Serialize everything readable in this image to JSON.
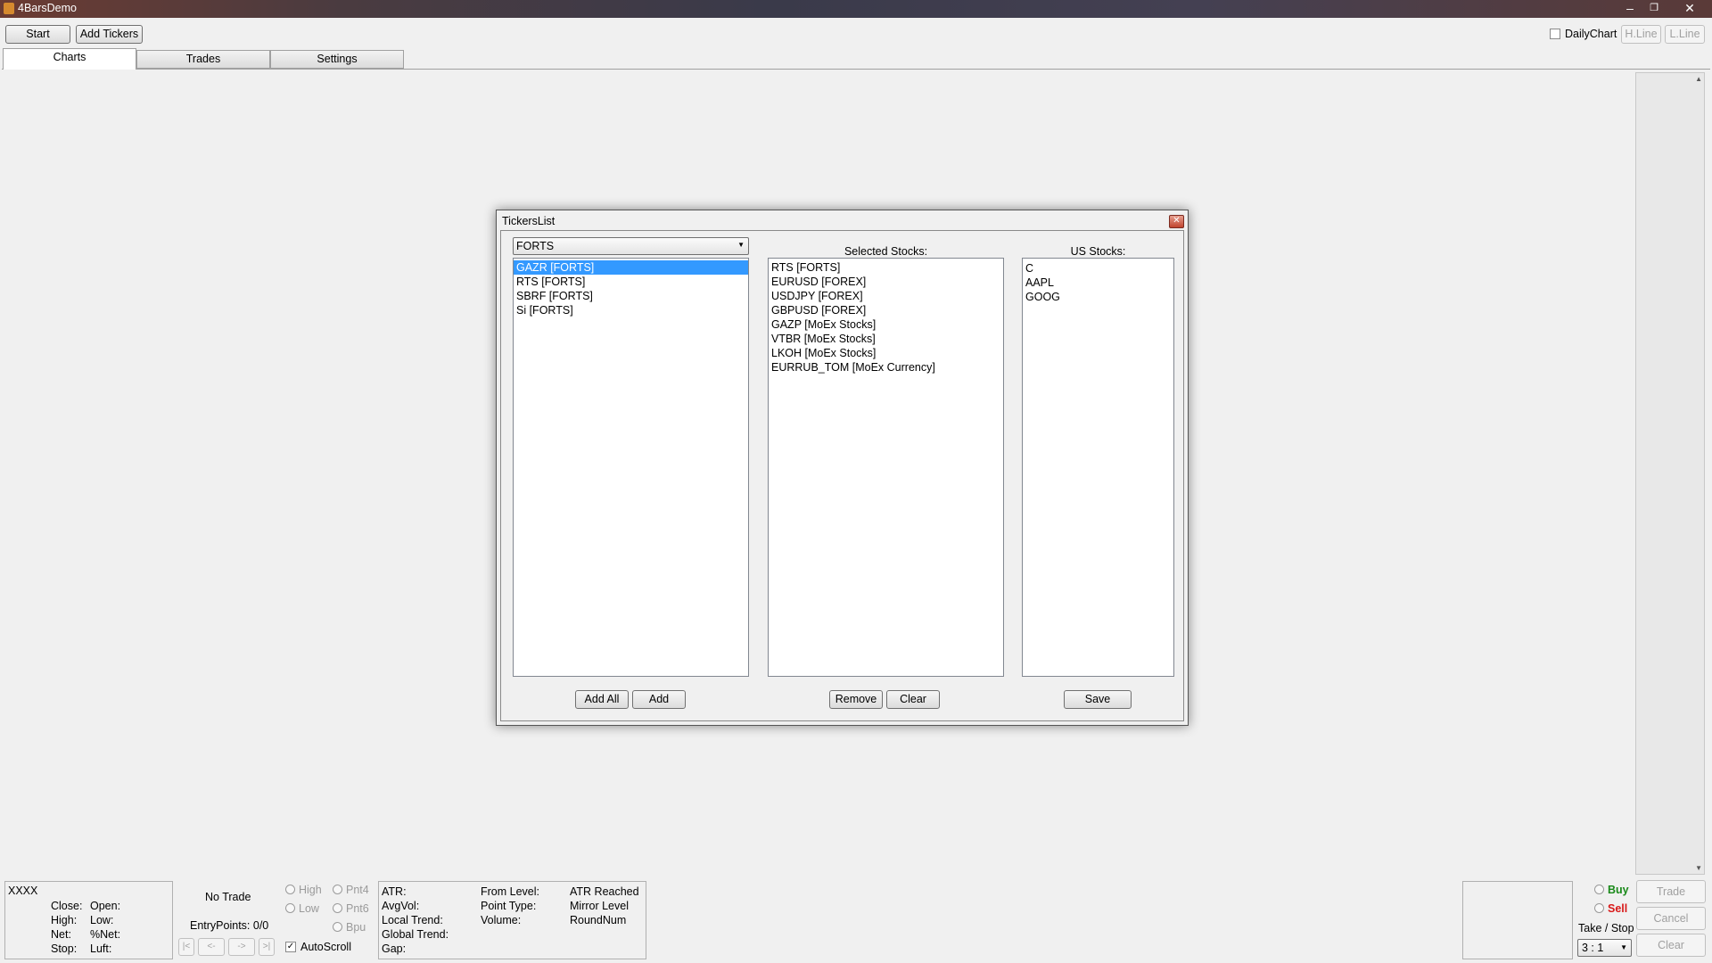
{
  "window": {
    "title": "4BarsDemo"
  },
  "toolbar": {
    "start_label": "Start",
    "add_tickers_label": "Add Tickers",
    "daily_chart_label": "DailyChart",
    "hline_label": "H.Line",
    "lline_label": "L.Line"
  },
  "tabs": [
    {
      "label": "Charts"
    },
    {
      "label": "Trades"
    },
    {
      "label": "Settings"
    }
  ],
  "dialog": {
    "title": "TickersList",
    "exchange_select": {
      "value": "FORTS"
    },
    "available": [
      "GAZR [FORTS]",
      "RTS [FORTS]",
      "SBRF [FORTS]",
      "Si [FORTS]"
    ],
    "selected_header": "Selected Stocks:",
    "selected": [
      "RTS [FORTS]",
      "EURUSD [FOREX]",
      "USDJPY [FOREX]",
      "GBPUSD [FOREX]",
      "GAZP [MoEx Stocks]",
      "VTBR [MoEx Stocks]",
      "LKOH [MoEx Stocks]",
      "EURRUB_TOM [MoEx Currency]"
    ],
    "us_header": "US Stocks:",
    "us_stocks": [
      "C",
      "AAPL",
      "GOOG"
    ],
    "buttons": {
      "add_all": "Add All",
      "add": "Add",
      "remove": "Remove",
      "clear": "Clear",
      "save": "Save"
    }
  },
  "info": {
    "ticker": "XXXX",
    "close": "Close:",
    "open": "Open:",
    "high": "High:",
    "low": "Low:",
    "net": "Net:",
    "pnet": "%Net:",
    "stop": "Stop:",
    "luft": "Luft:",
    "no_trade": "No Trade",
    "entry_points": "EntryPoints: 0/0",
    "nav": [
      "|<",
      "<-",
      "->",
      ">|"
    ],
    "autoscroll": "AutoScroll",
    "radios": {
      "high": "High",
      "low": "Low",
      "pnt4": "Pnt4",
      "pnt6": "Pnt6",
      "bpu": "Bpu"
    },
    "stats_col1": [
      "ATR:",
      "AvgVol:",
      "Local Trend:",
      "Global Trend:",
      "Gap:"
    ],
    "stats_col2": [
      "From Level:",
      "Point Type:",
      "Volume:"
    ],
    "stats_col3": [
      "ATR Reached",
      "Mirror Level",
      "RoundNum"
    ]
  },
  "trade": {
    "buy": "Buy",
    "sell": "Sell",
    "take_stop": "Take / Stop",
    "ratio": "3 : 1",
    "trade_btn": "Trade",
    "cancel_btn": "Cancel",
    "clear_btn": "Clear"
  },
  "colors": {
    "buy": "#1a8a1a",
    "sell": "#d81818",
    "selection": "#3399ff"
  }
}
